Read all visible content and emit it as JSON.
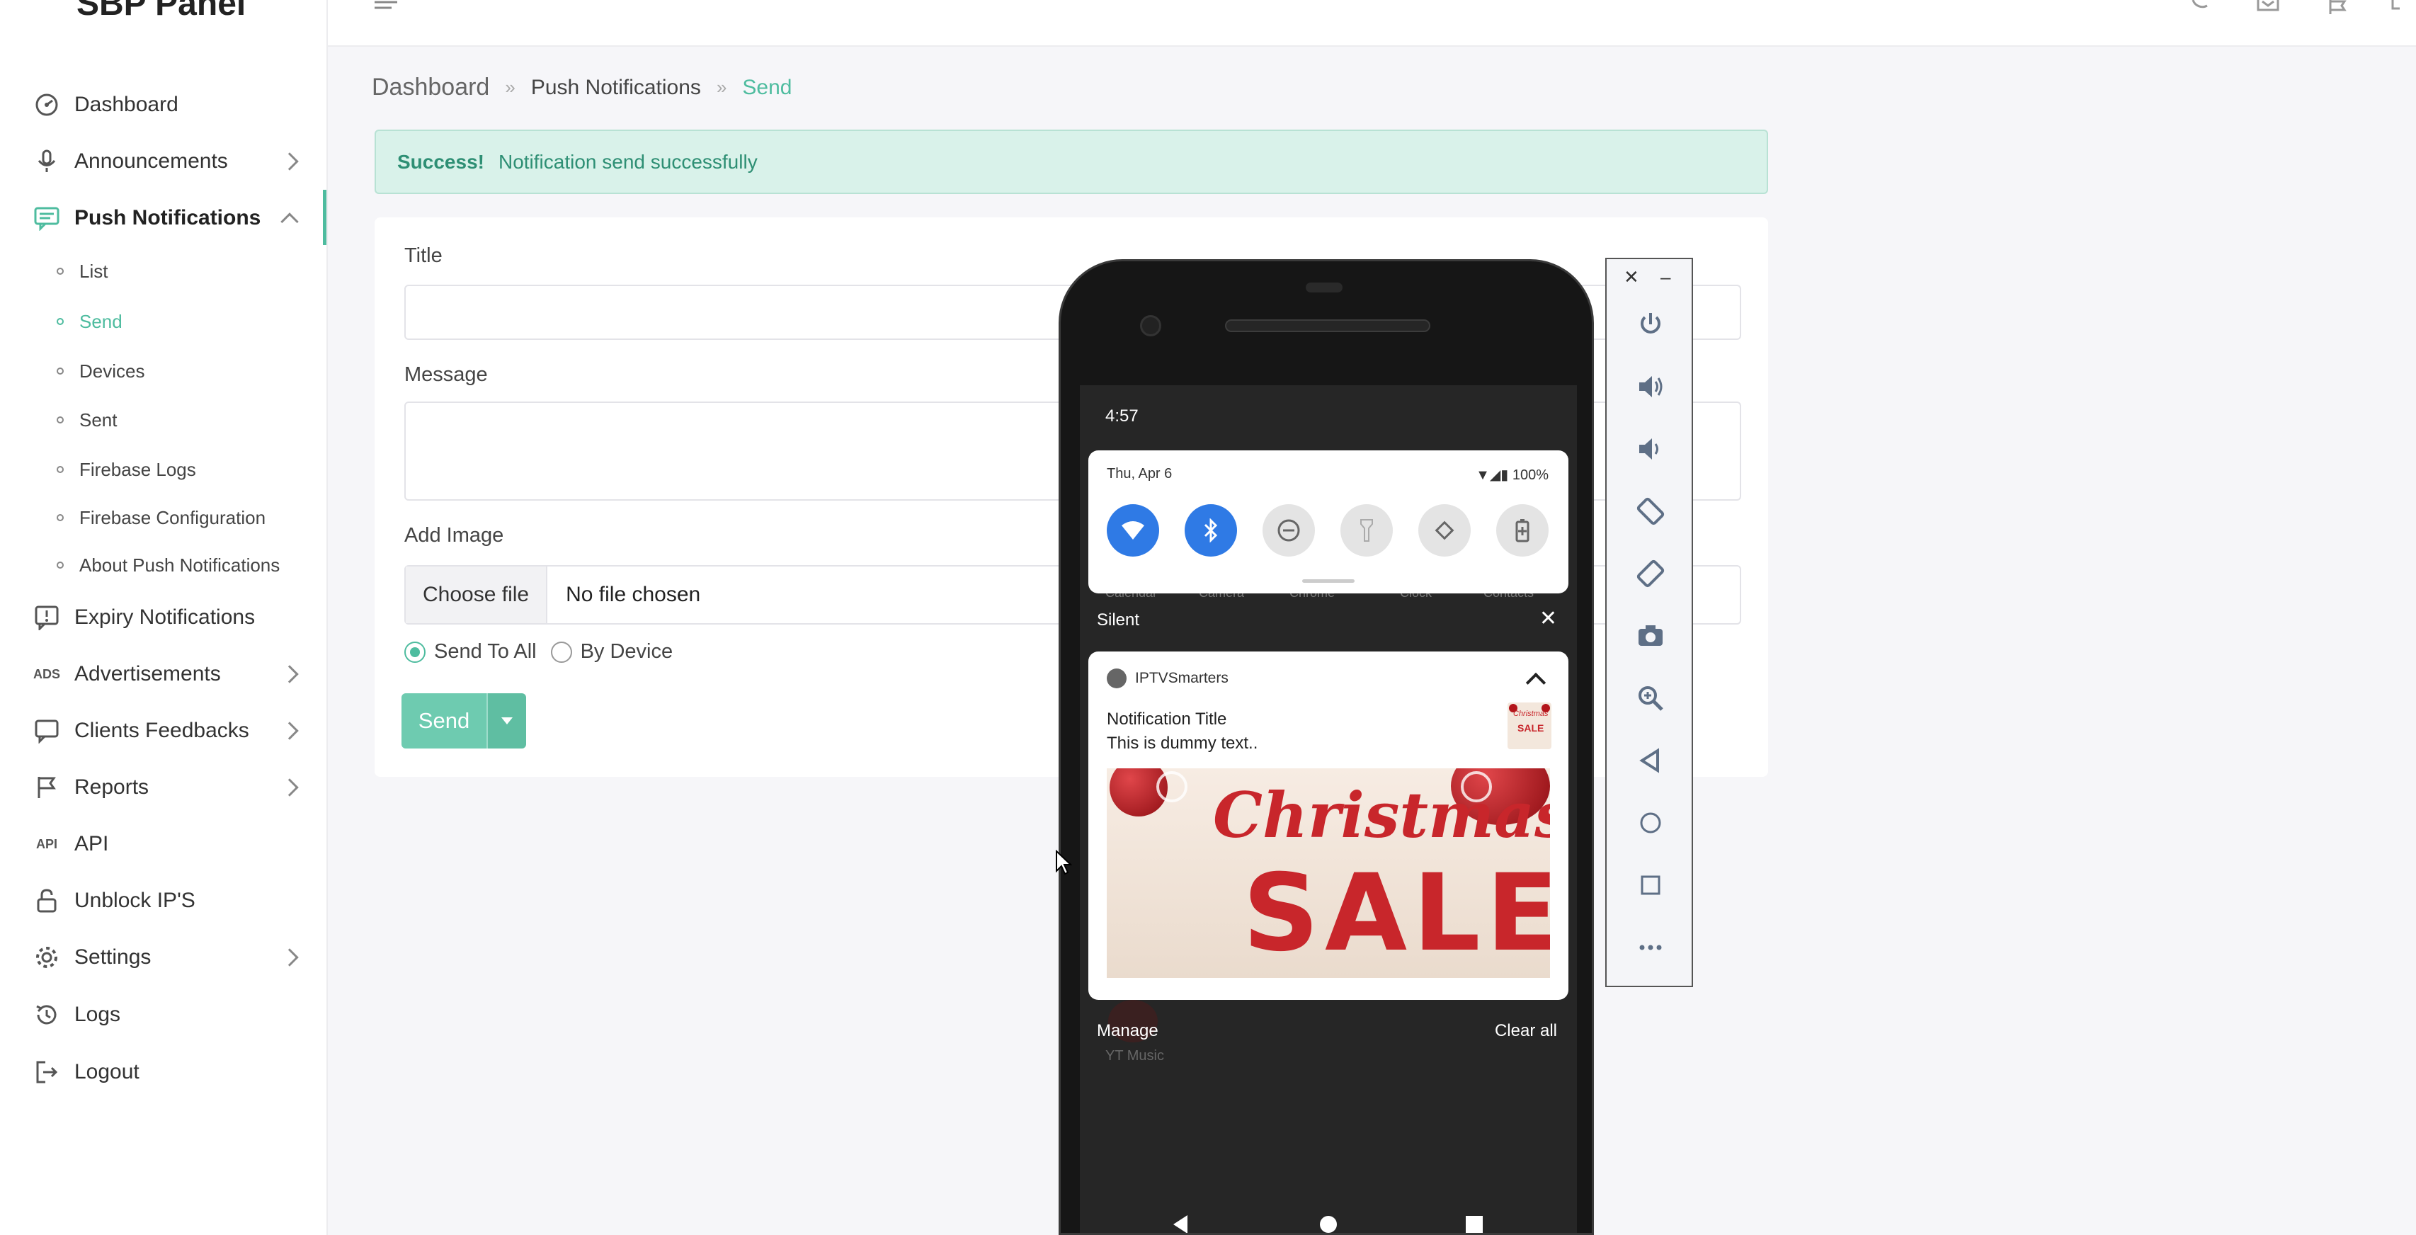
{
  "brand": "SBP Panel",
  "sidebar": {
    "items": [
      {
        "label": "Dashboard"
      },
      {
        "label": "Announcements"
      },
      {
        "label": "Push Notifications"
      },
      {
        "label": "Expiry Notifications"
      },
      {
        "label": "Advertisements"
      },
      {
        "label": "Clients Feedbacks"
      },
      {
        "label": "Reports"
      },
      {
        "label": "API"
      },
      {
        "label": "Unblock IP'S"
      },
      {
        "label": "Settings"
      },
      {
        "label": "Logs"
      },
      {
        "label": "Logout"
      }
    ],
    "subitems": [
      {
        "label": "List"
      },
      {
        "label": "Send"
      },
      {
        "label": "Devices"
      },
      {
        "label": "Sent"
      },
      {
        "label": "Firebase Logs"
      },
      {
        "label": "Firebase Configuration"
      },
      {
        "label": "About Push Notifications"
      }
    ],
    "icon_text": {
      "ads": "ADS",
      "api": "API"
    }
  },
  "breadcrumb": [
    "Dashboard",
    "Push Notifications",
    "Send"
  ],
  "alert": {
    "strong": "Success!",
    "text": "Notification send successfully"
  },
  "form": {
    "title_label": "Title",
    "title_value": "",
    "message_label": "Message",
    "message_value": "",
    "image_label": "Add Image",
    "choose_file": "Choose file",
    "no_file": "No file chosen",
    "radio_all": "Send To All",
    "radio_device": "By Device",
    "send": "Send"
  },
  "phone": {
    "time": "4:57",
    "date": "Thu, Apr 6",
    "battery": "100%",
    "behind_apps": [
      "Calendar",
      "Camera",
      "Chrome",
      "Clock",
      "Contacts"
    ],
    "silent": "Silent",
    "notification": {
      "app": "IPTVSmarters",
      "title": "Notification Title",
      "text": "This is dummy text..",
      "banner_line1": "Christmas",
      "banner_line2": "SALE"
    },
    "manage": "Manage",
    "clear_all": "Clear all",
    "behind_app_bottom": "YT Music"
  },
  "colors": {
    "accent": "#4ebc9f",
    "alert_bg": "#d9f2ea",
    "tile_on": "#2f7ae5"
  }
}
